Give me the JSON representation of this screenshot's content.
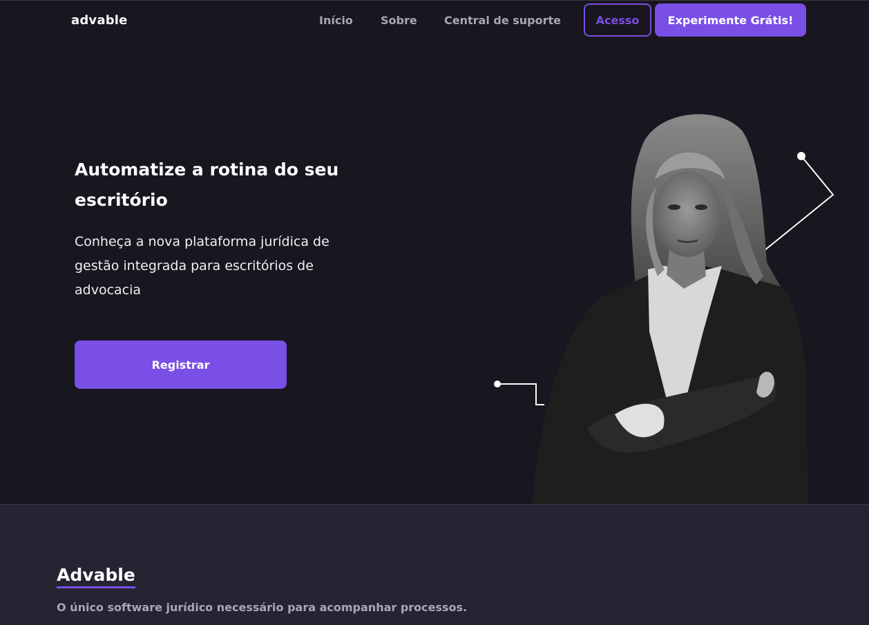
{
  "header": {
    "logo": "advable",
    "nav": [
      "Início",
      "Sobre",
      "Central de suporte"
    ],
    "login_label": "Acesso",
    "trial_label": "Experimente Grátis!"
  },
  "hero": {
    "title": "Automatize a rotina do seu escritório",
    "subtitle": "Conheça a nova plataforma jurídica de gestão integrada para escritórios de advocacia",
    "register_label": "Registrar"
  },
  "about": {
    "title": "Advable",
    "subtitle": "O único software jurídico necessário para acompanhar processos."
  },
  "colors": {
    "background": "#18161f",
    "accent": "#7a4fe6",
    "section": "#262433",
    "muted_text": "#a9a7b2"
  }
}
